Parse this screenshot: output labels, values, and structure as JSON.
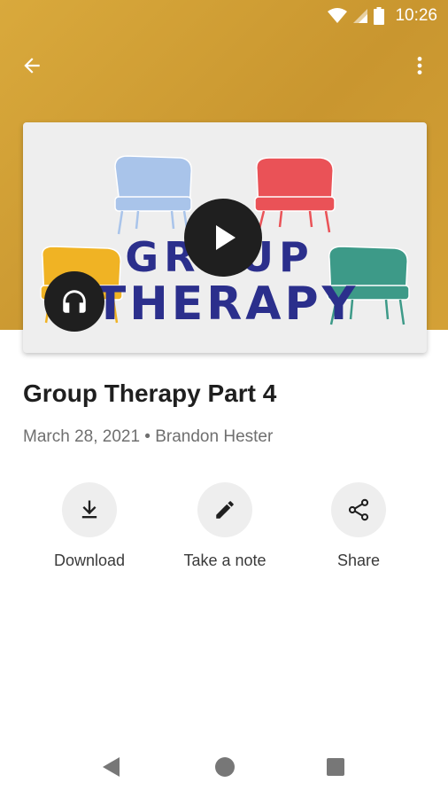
{
  "status_bar": {
    "time": "10:26"
  },
  "app_bar": {
    "back_icon": "arrow-back-icon",
    "more_icon": "more-vert-icon"
  },
  "artwork": {
    "text_line1": "GROUP",
    "text_line2": "THERAPY",
    "colors": {
      "blue_chair": "#a9c4ea",
      "red_chair": "#ea5257",
      "yellow_chair": "#f0b324",
      "green_chair": "#3d9a88",
      "lettering": "#2b2f8c"
    }
  },
  "episode": {
    "title": "Group Therapy Part 4",
    "meta": "March 28, 2021 • Brandon Hester"
  },
  "actions": [
    {
      "label": "Download",
      "icon": "download-icon"
    },
    {
      "label": "Take a note",
      "icon": "pencil-icon"
    },
    {
      "label": "Share",
      "icon": "share-icon"
    }
  ],
  "theme": {
    "header_color": "#d1a036",
    "text_primary": "#1f1f1f",
    "text_secondary": "#6f6f6f"
  }
}
